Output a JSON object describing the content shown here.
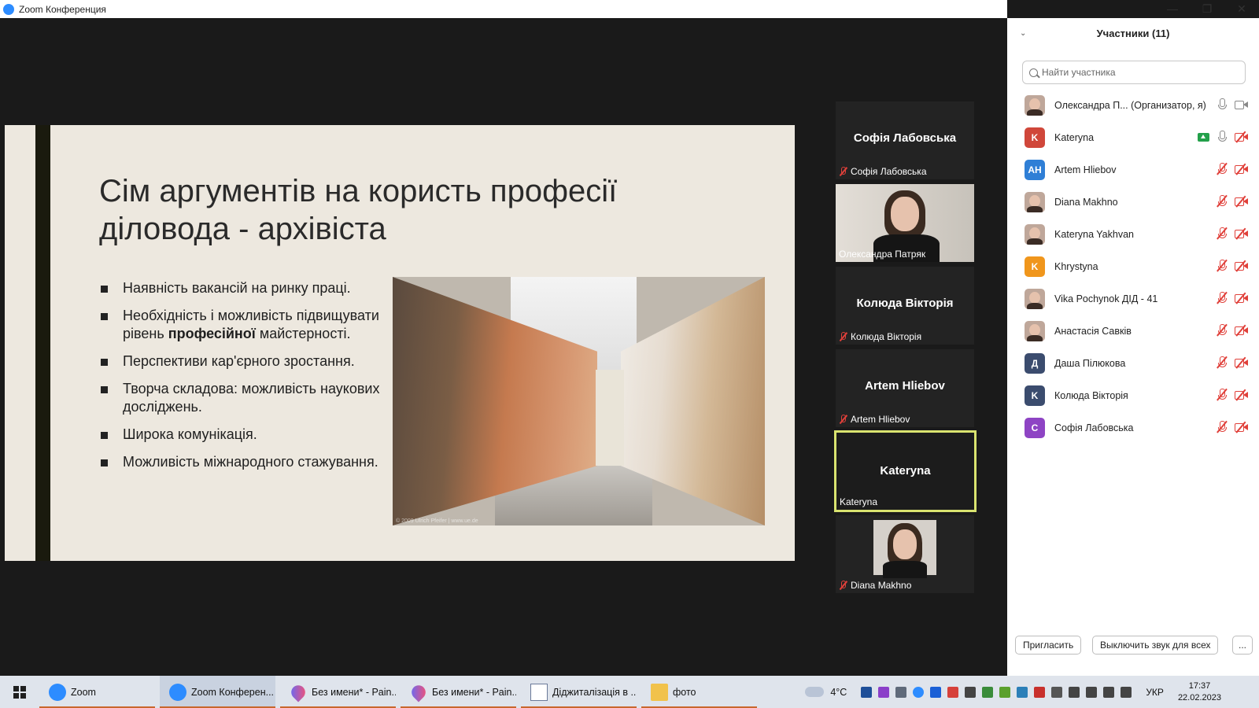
{
  "window": {
    "title": "Zoom Конференция",
    "controls": {
      "minimize": "—",
      "restore": "❐",
      "close": "✕"
    }
  },
  "slide": {
    "title": "Сім аргументів на користь професії діловода - архівіста",
    "bullets": [
      {
        "text": "Наявність вакансій на ринку праці."
      },
      {
        "before": "Необхідність і можливість підвищувати рівень ",
        "bold": "професійної",
        "after": " майстерності."
      },
      {
        "text": "Перспективи кар'єрного зростання."
      },
      {
        "text": "Творча складова: можливість наукових досліджень."
      },
      {
        "text": "Широка комунікація."
      },
      {
        "text": "Можливість міжнародного стажування."
      }
    ],
    "photo_watermark": "© 2009 Ulrich Pfeifer | www.ue.de"
  },
  "video_tiles": [
    {
      "display_name": "Софія Лабовська",
      "label": "Софія Лабовська",
      "muted": true,
      "video": false
    },
    {
      "display_name": "",
      "label": "Олександра Патряк",
      "muted": false,
      "video": true
    },
    {
      "display_name": "Колюда Вікторія",
      "label": "Колюда Вікторія",
      "muted": true,
      "video": false
    },
    {
      "display_name": "Artem Hliebov",
      "label": "Artem Hliebov",
      "muted": true,
      "video": false
    },
    {
      "display_name": "Kateryna",
      "label": "Kateryna",
      "muted": false,
      "video": false,
      "active": true
    },
    {
      "display_name": "",
      "label": "Diana Makhno",
      "muted": true,
      "video": true
    }
  ],
  "panel": {
    "title": "Участники (11)",
    "search_placeholder": "Найти участника",
    "participants": [
      {
        "name": "Олександра П... (Организатор, я)",
        "avatar": "",
        "avatar_color": "",
        "photo": true,
        "mic": "on",
        "cam": "on"
      },
      {
        "name": "Kateryna",
        "avatar": "K",
        "avatar_color": "#d0473a",
        "photo": false,
        "mic": "on",
        "cam": "off",
        "sharing": true
      },
      {
        "name": "Artem Hliebov",
        "avatar": "AH",
        "avatar_color": "#2f7fd6",
        "photo": false,
        "mic": "off",
        "cam": "off"
      },
      {
        "name": "Diana Makhno",
        "avatar": "",
        "avatar_color": "",
        "photo": true,
        "mic": "off",
        "cam": "off"
      },
      {
        "name": "Kateryna Yakhvan",
        "avatar": "",
        "avatar_color": "",
        "photo": true,
        "mic": "off",
        "cam": "off"
      },
      {
        "name": "Khrystyna",
        "avatar": "K",
        "avatar_color": "#f0961c",
        "photo": false,
        "mic": "off",
        "cam": "off"
      },
      {
        "name": "Vika Pochynok ДІД - 41",
        "avatar": "",
        "avatar_color": "",
        "photo": true,
        "mic": "off",
        "cam": "off"
      },
      {
        "name": "Анастасія Савків",
        "avatar": "",
        "avatar_color": "",
        "photo": true,
        "mic": "off",
        "cam": "off"
      },
      {
        "name": "Даша Пілюкова",
        "avatar": "Д",
        "avatar_color": "#3b4c6e",
        "photo": false,
        "mic": "off",
        "cam": "off"
      },
      {
        "name": "Колюда Вікторія",
        "avatar": "K",
        "avatar_color": "#3b4c6e",
        "photo": false,
        "mic": "off",
        "cam": "off"
      },
      {
        "name": "Софія Лабовська",
        "avatar": "C",
        "avatar_color": "#8e44c4",
        "photo": false,
        "mic": "off",
        "cam": "off"
      }
    ],
    "invite_label": "Пригласить",
    "mute_all_label": "Выключить звук для всех",
    "more_label": "..."
  },
  "taskbar": {
    "items": [
      {
        "label": "Zoom",
        "icon": "zoom",
        "active": false,
        "underline": true
      },
      {
        "label": "Zoom Конферен...",
        "icon": "zoom",
        "active": true,
        "underline": true
      },
      {
        "label": "Без имени* - Pain...",
        "icon": "paint",
        "active": false,
        "underline": true
      },
      {
        "label": "Без имени* - Pain...",
        "icon": "paint",
        "active": false,
        "underline": true
      },
      {
        "label": "Діджиталізація в ...",
        "icon": "doc",
        "active": false,
        "underline": true
      },
      {
        "label": "фото",
        "icon": "folder",
        "active": false,
        "underline": true
      }
    ],
    "weather": "4°C",
    "language": "УКР",
    "time": "17:37",
    "date": "22.02.2023"
  }
}
